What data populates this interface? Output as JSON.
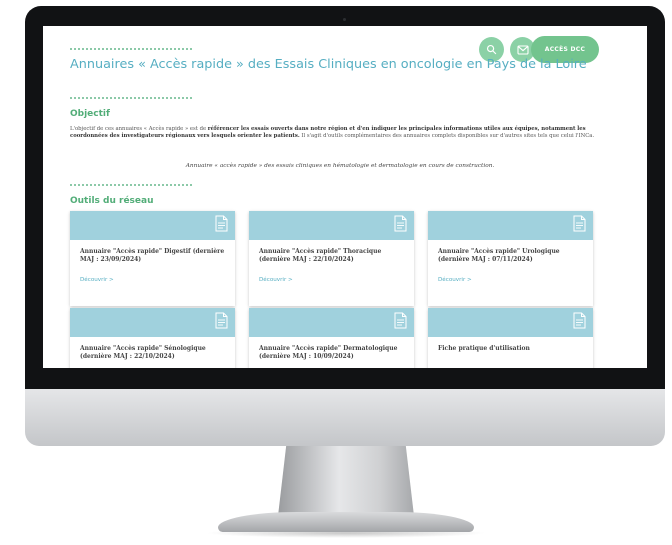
{
  "header": {
    "access_button_label": "ACCÈS DCC",
    "search_icon": "search-icon",
    "mail_icon": "mail-icon"
  },
  "page": {
    "title": "Annuaires « Accès rapide » des Essais Cliniques en oncologie en Pays de la Loire"
  },
  "objective": {
    "heading": "Objectif",
    "text_prefix": "L'objectif de ces annuaires « Accès rapide » est de ",
    "text_bold": "référencer les essais ouverts dans notre région et d'en indiquer les principales informations utiles aux équipes, notamment les coordonnées des investigateurs régionaux vers lesquels orienter les patients.",
    "text_suffix": " Il s'agit d'outils complémentaires des annuaires complets disponibles sur d'autres sites tels que celui l'INCa.",
    "note": "Annuaire « accès rapide » des essais cliniques en hématologie et dermatologie en cours de construction."
  },
  "network": {
    "heading": "Outils du réseau",
    "cards": [
      {
        "title": "Annuaire \"Accès rapide\" Digestif (dernière MAJ : 23/09/2024)",
        "link": "Découvrir  >"
      },
      {
        "title": "Annuaire \"Accès rapide\" Thoracique (dernière MAJ : 22/10/2024)",
        "link": "Découvrir  >"
      },
      {
        "title": "Annuaire \"Accès rapide\" Urologique (dernière MAJ : 07/11/2024)",
        "link": "Découvrir  >"
      },
      {
        "title": "Annuaire \"Accès rapide\" Sénologique (dernière MAJ : 22/10/2024)",
        "link": ""
      },
      {
        "title": "Annuaire \"Accès rapide\" Dermatologique (dernière MAJ : 10/09/2024)",
        "link": ""
      },
      {
        "title": "Fiche pratique d'utilisation",
        "link": ""
      }
    ]
  },
  "colors": {
    "accent_teal": "#56aec2",
    "accent_green": "#52ad78",
    "card_band": "#a0d1dd",
    "button_green": "#73c48e"
  }
}
